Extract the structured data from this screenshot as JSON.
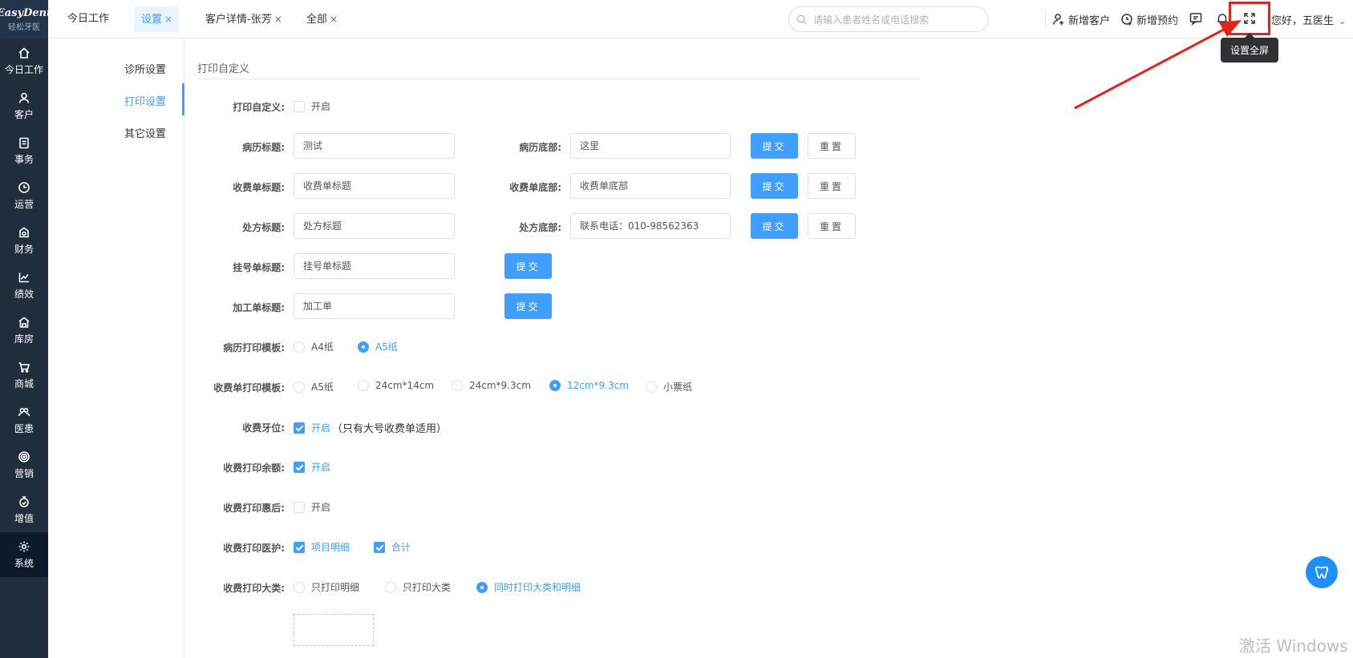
{
  "sidebar": {
    "logo_main": "EasyDent",
    "logo_sub": "轻松牙医",
    "items": [
      {
        "label": "今日工作",
        "icon": "home-icon"
      },
      {
        "label": "客户",
        "icon": "user-icon"
      },
      {
        "label": "事务",
        "icon": "clipboard-icon"
      },
      {
        "label": "运营",
        "icon": "clock-icon"
      },
      {
        "label": "财务",
        "icon": "wallet-icon"
      },
      {
        "label": "绩效",
        "icon": "chart-line-icon"
      },
      {
        "label": "库房",
        "icon": "warehouse-icon"
      },
      {
        "label": "商城",
        "icon": "cart-icon"
      },
      {
        "label": "医患",
        "icon": "people-icon"
      },
      {
        "label": "营销",
        "icon": "target-icon"
      },
      {
        "label": "增值",
        "icon": "gift-icon"
      },
      {
        "label": "系统",
        "icon": "gear-icon",
        "active": true
      }
    ]
  },
  "topbar": {
    "tabs": [
      {
        "label": "今日工作",
        "closable": false
      },
      {
        "label": "设置",
        "closable": true,
        "active": true
      },
      {
        "label": "客户详情-张芳",
        "closable": true
      },
      {
        "label": "全部",
        "closable": true
      }
    ],
    "close_glyph": "×",
    "search_placeholder": "请输入患者姓名或电话搜索",
    "new_customer": "新增客户",
    "new_appointment": "新增预约",
    "greeting": "您好，五医生",
    "fullscreen_tooltip": "设置全屏"
  },
  "submenu": {
    "items": [
      "诊所设置",
      "打印设置",
      "其它设置"
    ],
    "active_index": 1
  },
  "main": {
    "section_title": "打印自定义",
    "print_custom": {
      "label": "打印自定义:",
      "option": "开启",
      "checked": false
    },
    "rows": [
      {
        "label1": "病历标题:",
        "value1": "测试",
        "label2": "病历底部:",
        "value2": "这里",
        "submit": "提交",
        "reset": "重置"
      },
      {
        "label1": "收费单标题:",
        "value1": "收费单标题",
        "label2": "收费单底部:",
        "value2": "收费单底部",
        "submit": "提交",
        "reset": "重置"
      },
      {
        "label1": "处方标题:",
        "value1": "处方标题",
        "label2": "处方底部:",
        "value2": "联系电话：010-98562363",
        "submit": "提交",
        "reset": "重置"
      },
      {
        "label1": "挂号单标题:",
        "value1": "挂号单标题",
        "submit": "提交"
      },
      {
        "label1": "加工单标题:",
        "value1": "加工单",
        "submit": "提交"
      }
    ],
    "record_template": {
      "label": "病历打印模板:",
      "options": [
        "A4纸",
        "A5纸"
      ],
      "selected": "A5纸"
    },
    "receipt_template": {
      "label": "收费单打印模板:",
      "options": [
        "A5纸",
        "24cm*14cm",
        "24cm*9.3cm",
        "12cm*9.3cm",
        "小票纸"
      ],
      "selected": "12cm*9.3cm"
    },
    "tooth_position": {
      "label": "收费牙位:",
      "option": "开启",
      "checked": true,
      "note": "（只有大号收费单适用）"
    },
    "balance": {
      "label": "收费打印余额:",
      "option": "开启",
      "checked": true
    },
    "discount": {
      "label": "收费打印惠后:",
      "option": "开启",
      "checked": false
    },
    "medical": {
      "label": "收费打印医护:",
      "options": [
        {
          "text": "项目明细",
          "checked": true
        },
        {
          "text": "合计",
          "checked": true
        }
      ]
    },
    "category": {
      "label": "收费打印大类:",
      "options": [
        "只打印明细",
        "只打印大类",
        "同时打印大类和明细"
      ],
      "selected": "同时打印大类和明细"
    }
  },
  "watermark": "激活 Windows",
  "colors": {
    "primary": "#409eff",
    "sidebar_bg": "#1f2d3d",
    "highlight": "#e5211c"
  }
}
